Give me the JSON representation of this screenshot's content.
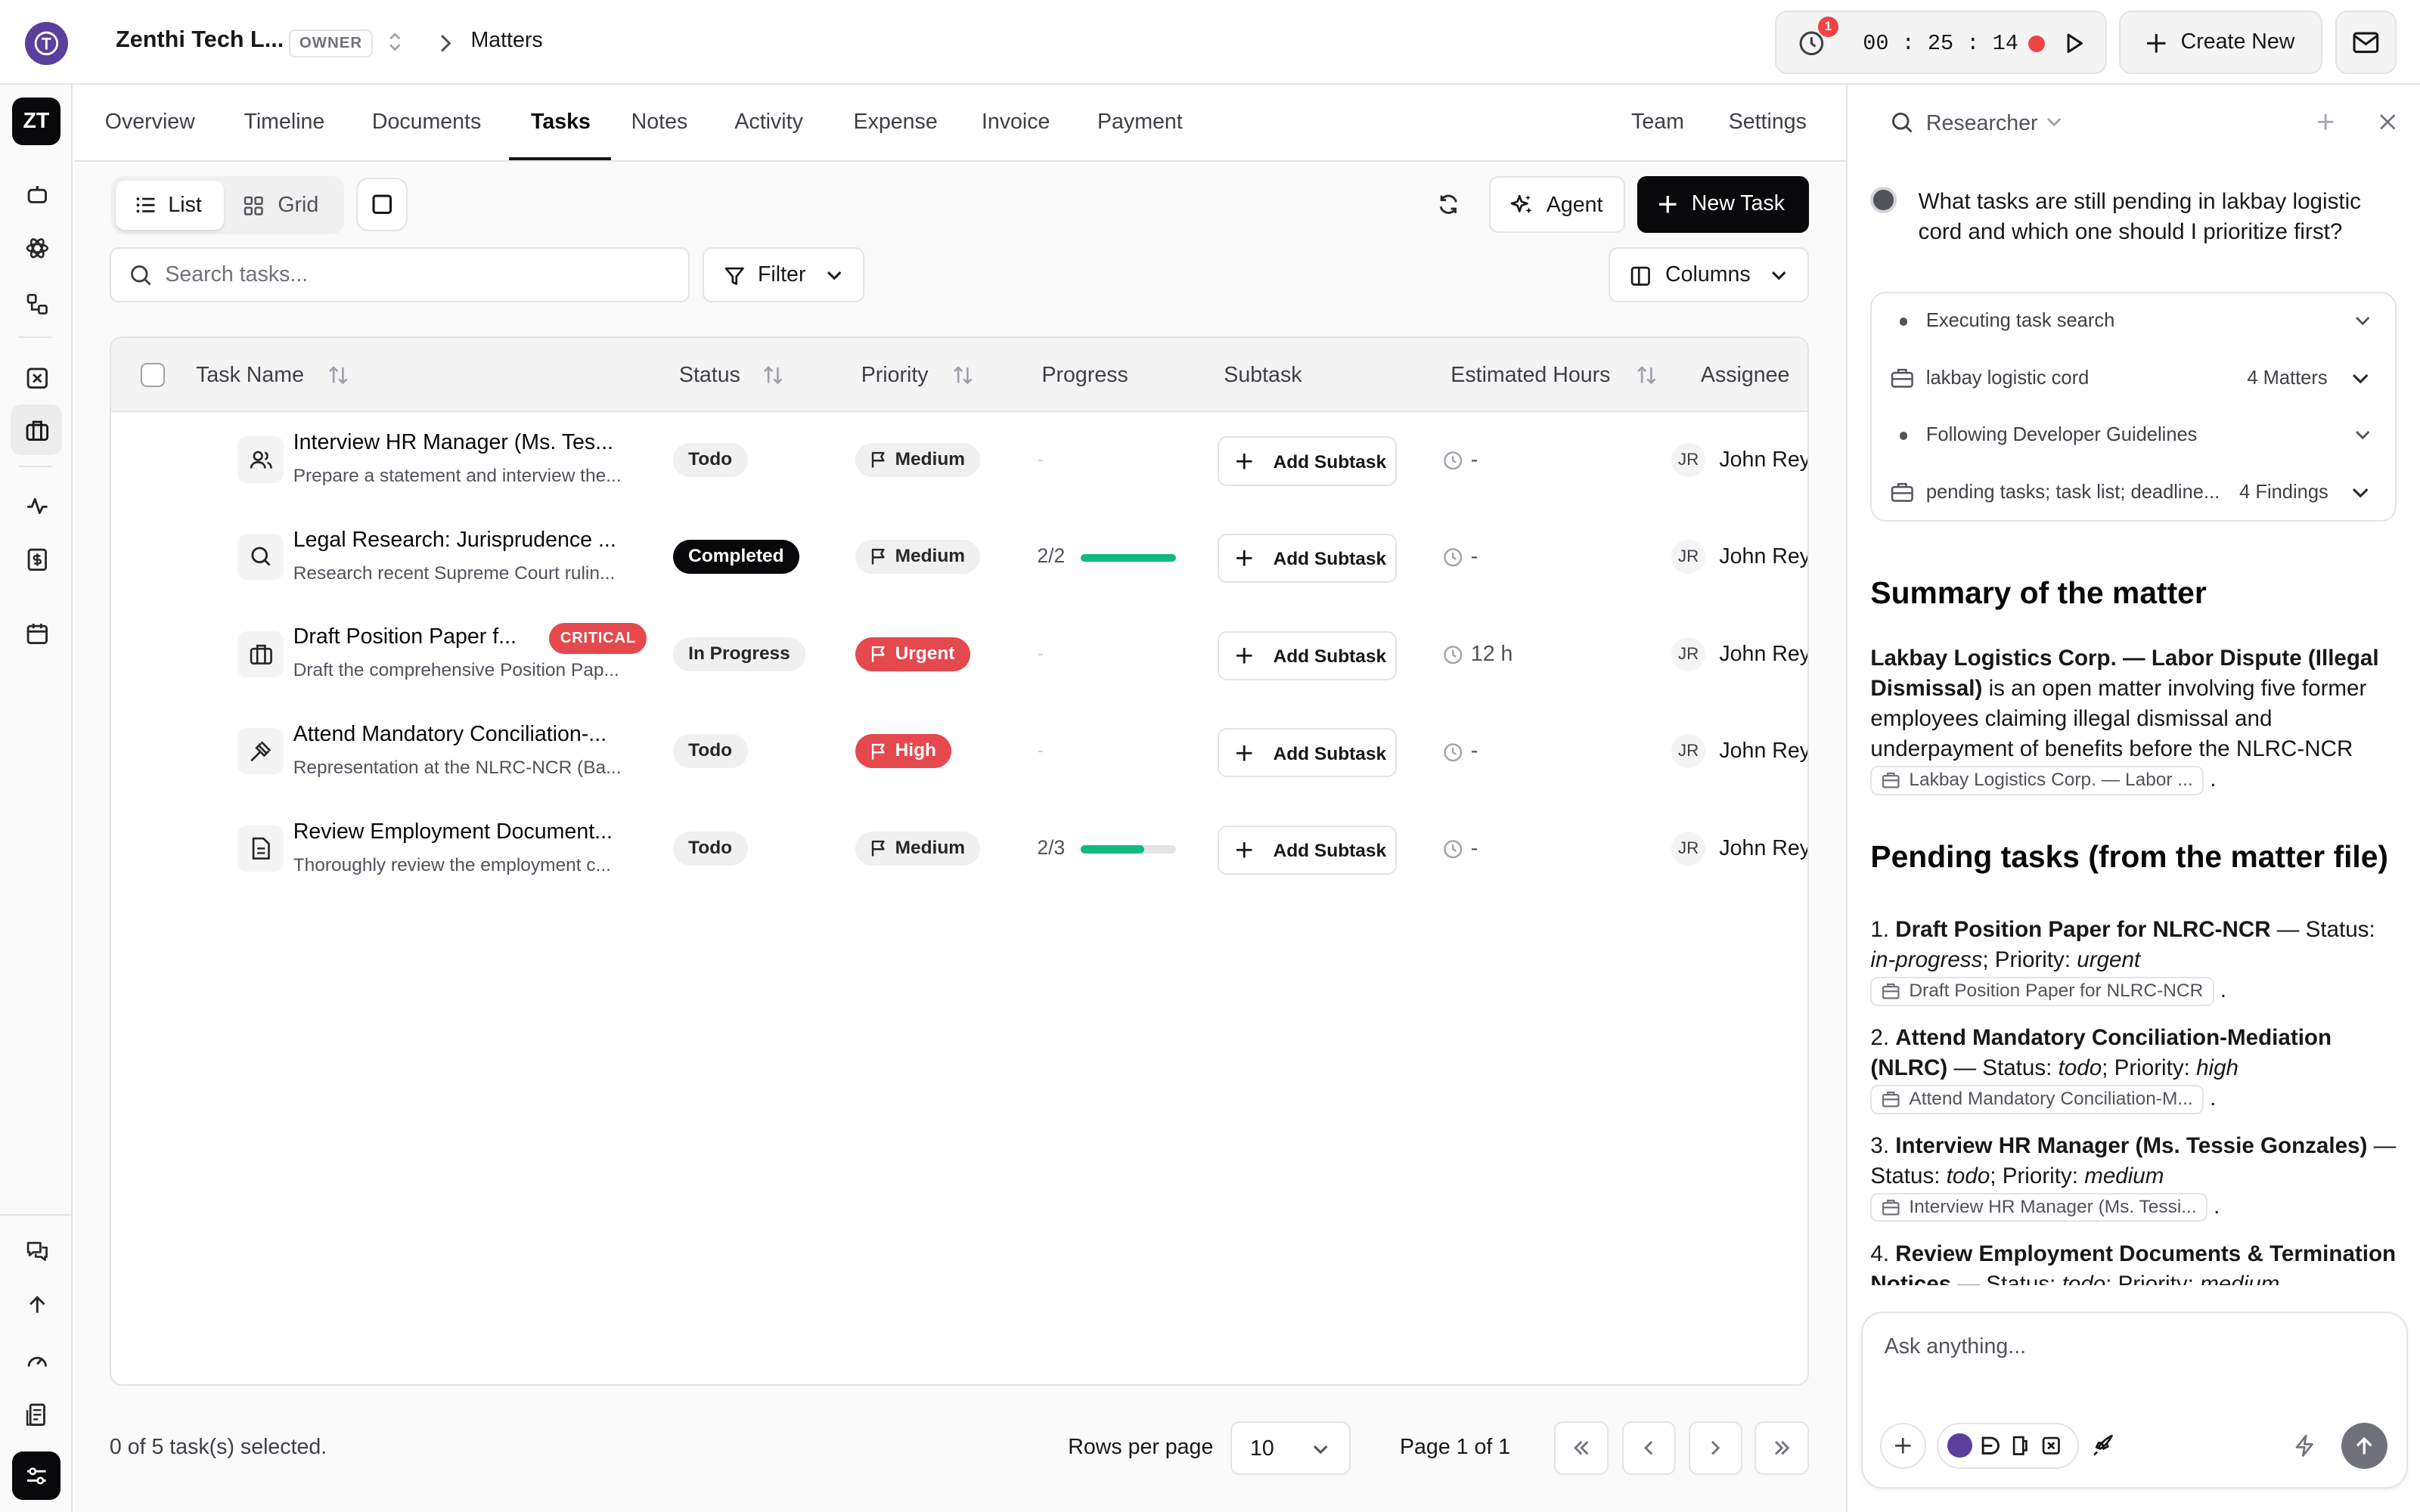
{
  "header": {
    "org_name": "Zenthi Tech L...",
    "role_badge": "OWNER",
    "breadcrumb": "Matters",
    "timer": {
      "notification_count": "1",
      "time": "00 : 25 : 14"
    },
    "create_new_label": "Create New"
  },
  "rail": {
    "workspace_initials": "ZT",
    "icons": [
      "chat-bot-icon",
      "atom-icon",
      "workflow-icon",
      "x-box-icon",
      "briefcase-icon",
      "activity-icon",
      "invoice-icon",
      "calendar-icon",
      "messages-icon",
      "arrow-up-icon",
      "gauge-icon",
      "report-icon",
      "sliders-icon"
    ]
  },
  "tabs": [
    {
      "label": "Overview"
    },
    {
      "label": "Timeline"
    },
    {
      "label": "Documents"
    },
    {
      "label": "Tasks",
      "active": true
    },
    {
      "label": "Notes"
    },
    {
      "label": "Activity"
    },
    {
      "label": "Expense"
    },
    {
      "label": "Invoice"
    },
    {
      "label": "Payment"
    }
  ],
  "tabs_right": [
    {
      "label": "Team"
    },
    {
      "label": "Settings"
    }
  ],
  "toolbar": {
    "view_list": "List",
    "view_grid": "Grid",
    "agent_label": "Agent",
    "new_task_label": "New Task",
    "search_placeholder": "Search tasks...",
    "filter_label": "Filter",
    "columns_label": "Columns"
  },
  "table": {
    "headers": {
      "task_name": "Task Name",
      "status": "Status",
      "priority": "Priority",
      "progress": "Progress",
      "subtask": "Subtask",
      "estimated_hours": "Estimated Hours",
      "assignee": "Assignee"
    },
    "rows": [
      {
        "icon": "users-icon",
        "name": "Interview HR Manager (Ms. Tes...",
        "desc": "Prepare a statement and interview the...",
        "badge": "",
        "status": "Todo",
        "priority": "Medium",
        "progress_text": "-",
        "progress_value": null,
        "subtask": "Add Subtask",
        "hours": "-",
        "assignee_initials": "JR",
        "assignee": "John Rey"
      },
      {
        "icon": "search-icon",
        "name": "Legal Research: Jurisprudence ...",
        "desc": "Research recent Supreme Court rulin...",
        "badge": "",
        "status": "Completed",
        "priority": "Medium",
        "progress_text": "2/2",
        "progress_value": 1.0,
        "subtask": "Add Subtask",
        "hours": "-",
        "assignee_initials": "JR",
        "assignee": "John Rey"
      },
      {
        "icon": "briefcase-icon",
        "name": "Draft Position Paper f...",
        "desc": "Draft the comprehensive Position Pap...",
        "badge": "CRITICAL",
        "status": "In Progress",
        "priority": "Urgent",
        "progress_text": "-",
        "progress_value": null,
        "subtask": "Add Subtask",
        "hours": "12 h",
        "assignee_initials": "JR",
        "assignee": "John Rey"
      },
      {
        "icon": "gavel-icon",
        "name": "Attend Mandatory Conciliation-...",
        "desc": "Representation at the NLRC-NCR (Ba...",
        "badge": "",
        "status": "Todo",
        "priority": "High",
        "progress_text": "-",
        "progress_value": null,
        "subtask": "Add Subtask",
        "hours": "-",
        "assignee_initials": "JR",
        "assignee": "John Rey"
      },
      {
        "icon": "document-icon",
        "name": "Review Employment Document...",
        "desc": "Thoroughly review the employment c...",
        "badge": "",
        "status": "Todo",
        "priority": "Medium",
        "progress_text": "2/3",
        "progress_value": 0.6667,
        "subtask": "Add Subtask",
        "hours": "-",
        "assignee_initials": "JR",
        "assignee": "John Rey"
      }
    ]
  },
  "footer": {
    "selection": "0 of 5 task(s) selected.",
    "rows_per_page_label": "Rows per page",
    "rows_per_page_value": "10",
    "page_text": "Page 1 of 1"
  },
  "assistant": {
    "mode": "Researcher",
    "question": "What tasks are still pending in lakbay logistic cord and which one should I prioritize first?",
    "steps": [
      {
        "label": "Executing task search",
        "meta": ""
      },
      {
        "label": "lakbay logistic cord",
        "meta": "4 Matters"
      },
      {
        "label": "Following Developer Guidelines",
        "meta": ""
      },
      {
        "label": "pending tasks; task list; deadline...",
        "meta": "4 Findings"
      }
    ],
    "summary_heading": "Summary of the matter",
    "summary_bold": "Lakbay Logistics Corp. — Labor Dispute (Illegal Dismissal)",
    "summary_rest": " is an open matter involving five former employees claiming illegal dismissal and underpayment of benefits before the NLRC-NCR",
    "summary_chip": "Lakbay Logistics Corp. — Labor ...",
    "pending_heading": "Pending tasks (from the matter file)",
    "pending": [
      {
        "num": "1.",
        "title": "Draft Position Paper for NLRC-NCR",
        "status_label": " — Status: ",
        "status": "in-progress",
        "priority_label": "; Priority: ",
        "priority": "urgent",
        "chip": "Draft Position Paper for NLRC-NCR"
      },
      {
        "num": "2.",
        "title": "Attend Mandatory Conciliation-Mediation (NLRC)",
        "status_label": " — Status: ",
        "status": "todo",
        "priority_label": "; Priority: ",
        "priority": "high",
        "chip": "Attend Mandatory Conciliation-M..."
      },
      {
        "num": "3.",
        "title": "Interview HR Manager (Ms. Tessie Gonzales)",
        "status_label": " — Status: ",
        "status": "todo",
        "priority_label": "; Priority: ",
        "priority": "medium",
        "chip": "Interview HR Manager (Ms. Tessi..."
      },
      {
        "num": "4.",
        "title": "Review Employment Documents & Termination Notices",
        "status_label": " — Status: ",
        "status": "todo",
        "priority_label": "; Priority: ",
        "priority": "medium",
        "chip": ""
      }
    ],
    "input_placeholder": "Ask anything..."
  },
  "colors": {
    "accent": "#09090b",
    "urgent": "#e5484d",
    "progress": "#10b981",
    "record": "#ef4444",
    "brand": "#5b3f9c"
  }
}
